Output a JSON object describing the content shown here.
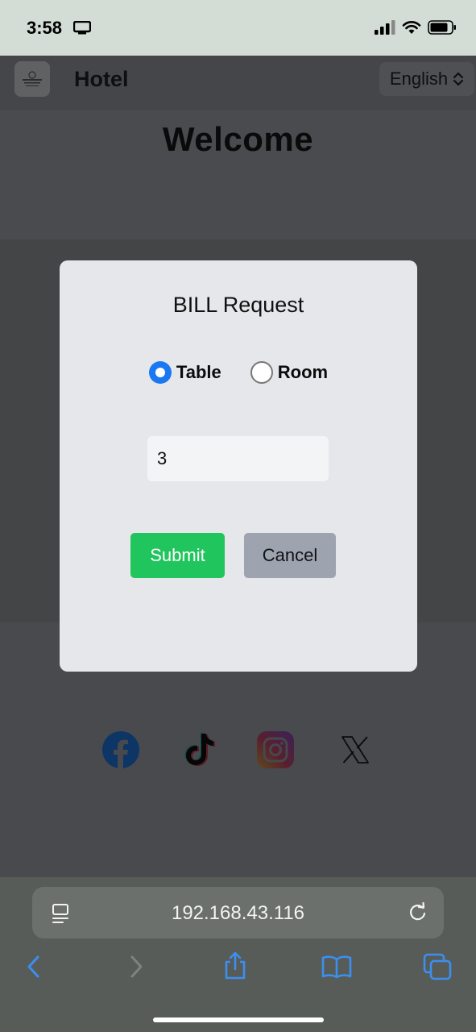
{
  "status": {
    "time": "3:58",
    "icons": [
      "screen-mirroring-icon",
      "cellular-signal-icon",
      "wifi-icon",
      "battery-icon"
    ]
  },
  "header": {
    "logo_icon": "hotel-logo",
    "title": "Hotel",
    "language": "English"
  },
  "welcome": {
    "title": "Welcome"
  },
  "modal": {
    "title": "BILL Request",
    "radio_options": [
      {
        "label": "Table",
        "checked": true
      },
      {
        "label": "Room",
        "checked": false
      }
    ],
    "number_value": "3",
    "submit_label": "Submit",
    "cancel_label": "Cancel"
  },
  "social": [
    "facebook-icon",
    "tiktok-icon",
    "instagram-icon",
    "x-icon"
  ],
  "browser": {
    "url": "192.168.43.116",
    "toolbar": [
      "back-icon",
      "forward-icon",
      "share-icon",
      "bookmarks-icon",
      "tabs-icon"
    ]
  },
  "colors": {
    "accent_blue": "#1a78f2",
    "submit_green": "#21c55d",
    "cancel_gray": "#9ea3b0"
  }
}
